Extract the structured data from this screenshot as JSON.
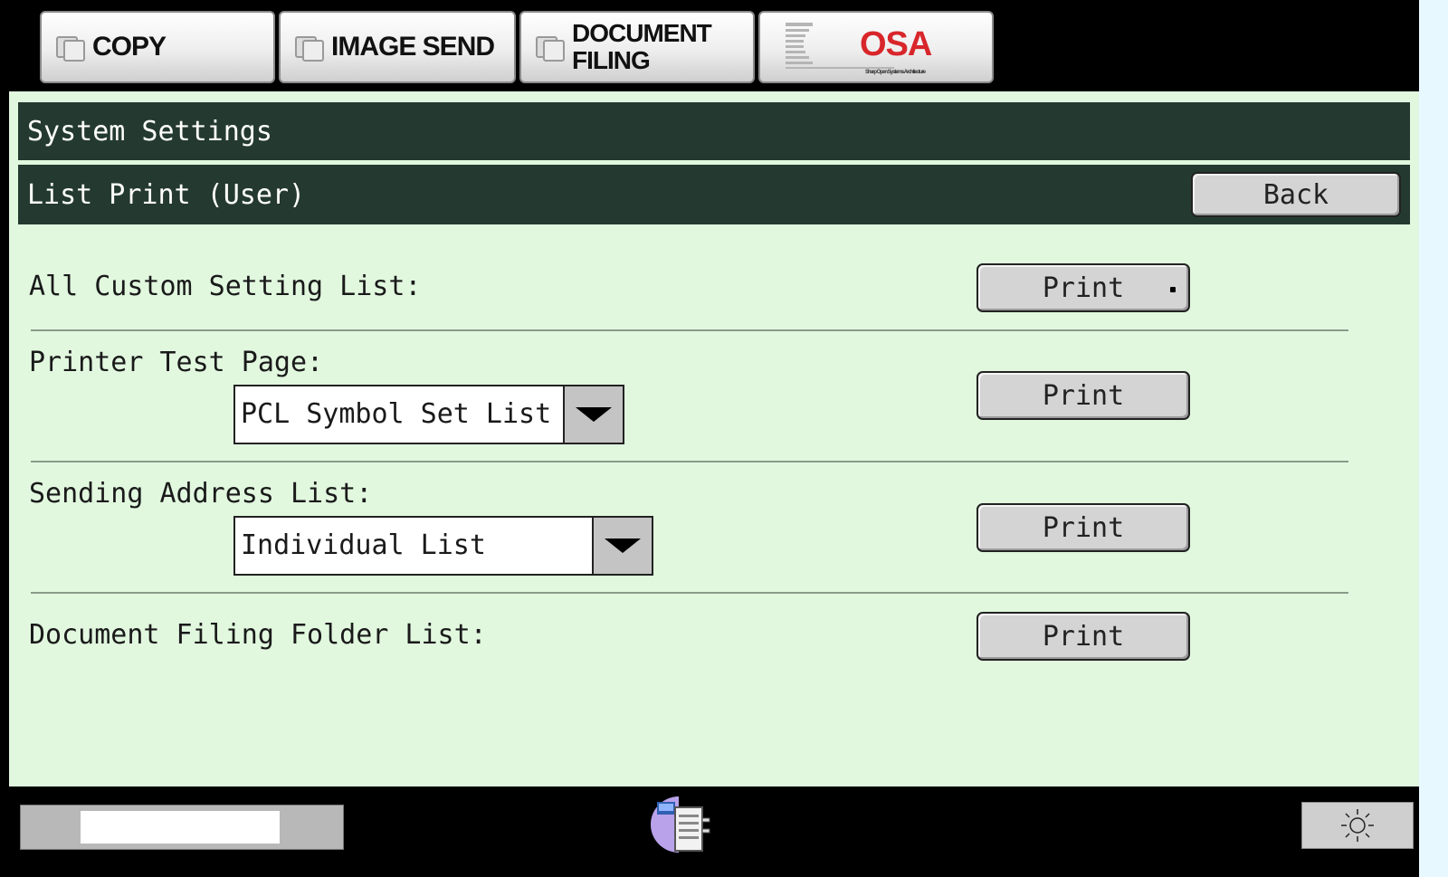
{
  "tabs": {
    "copy": "COPY",
    "image_send": "IMAGE SEND",
    "document_filing_line1": "DOCUMENT",
    "document_filing_line2": "FILING",
    "osa_logo": "OSA",
    "osa_tagline": "Sharp Open Systems Architecture"
  },
  "header": {
    "title": "System Settings",
    "subtitle": "List Print (User)",
    "back_label": "Back"
  },
  "rows": [
    {
      "label": "All Custom Setting List:",
      "button": "Print"
    },
    {
      "label": "Printer Test Page:",
      "select_value": "PCL Symbol Set List",
      "button": "Print"
    },
    {
      "label": "Sending Address List:",
      "select_value": "Individual List",
      "button": "Print"
    },
    {
      "label": "Document Filing Folder List:",
      "button": "Print"
    }
  ],
  "colors": {
    "background": "#e1f8df",
    "header_bar": "#243a30",
    "logo_red": "#d8262b"
  },
  "icons": {
    "job_status": "printer-status-icon",
    "brightness": "sun-icon"
  }
}
